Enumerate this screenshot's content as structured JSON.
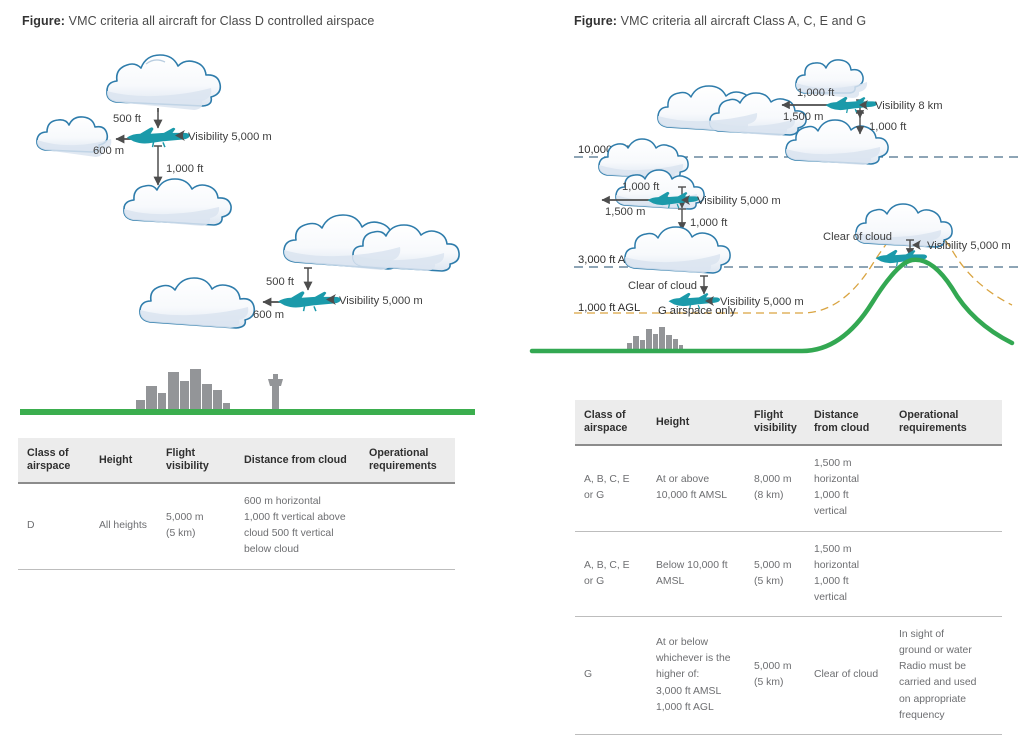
{
  "left_panel": {
    "caption_prefix": "Figure:",
    "caption_text": " VMC criteria all aircraft for Class D controlled airspace",
    "diagram": {
      "labels": {
        "top_vertical": "500 ft",
        "horizontal": "600 m",
        "visibility_top": "Visibility 5,000 m",
        "bottom_vertical": "1,000 ft",
        "lower_vertical": "500 ft",
        "lower_horizontal": "600 m",
        "visibility_lower": "Visibility 5,000 m"
      },
      "colors": {
        "aircraft": "#1b9aaa",
        "ground": "#3bae4e",
        "city": "#939598",
        "cloud_outline": "#2e7cab",
        "cloud_fill": "#ffffff",
        "cloud_shade": "#e2e9f2",
        "arrow": "#4d4d4d"
      }
    },
    "table": {
      "headers": [
        "Class of airspace",
        "Height",
        "Flight visibility",
        "Distance from cloud",
        "Operational requirements"
      ],
      "rows": [
        {
          "class": "D",
          "height": "All heights",
          "visibility": [
            "5,000 m",
            "(5 km)"
          ],
          "distance": [
            "600 m horizontal",
            "1,000 ft vertical above",
            "cloud 500 ft vertical",
            "below cloud"
          ],
          "operational": ""
        }
      ]
    }
  },
  "right_panel": {
    "caption_prefix": "Figure:",
    "caption_text": " VMC criteria all aircraft Class A, C, E and G",
    "diagram": {
      "labels": {
        "a1_vert_top": "1,000 ft",
        "a1_horiz": "1,500 m",
        "a1_vis": "Visibility 8 km",
        "a1_vert_bottom": "1,000 ft",
        "level_10000": "10,000 ft AMSL",
        "a2_vert_top": "1,000 ft",
        "a2_horiz": "1,500 m",
        "a2_vis": "Visibility 5,000 m",
        "a2_vert_bottom": "1,000 ft",
        "level_3000": "3,000 ft AMSL",
        "a3_clear": "Clear of cloud",
        "a3_vis": "Visibility 5,000 m",
        "a3_note": "G airspace only",
        "level_1000": "1,000 ft AGL",
        "a4_clear": "Clear of cloud",
        "a4_vis": "Visibility 5,000 m"
      },
      "colors": {
        "aircraft": "#1b9aaa",
        "terrain": "#33a852",
        "city": "#939598",
        "amsl_line": "#4a6f8a",
        "agl_line": "#d9a441",
        "cloud_outline": "#2e7cab"
      }
    },
    "table": {
      "headers": [
        "Class of airspace",
        "Height",
        "Flight visibility",
        "Distance from cloud",
        "Operational requirements"
      ],
      "rows": [
        {
          "class": [
            "A, B, C, E",
            "or G"
          ],
          "height": [
            "At or above",
            "10,000 ft AMSL"
          ],
          "visibility": [
            "8,000 m",
            "(8 km)"
          ],
          "distance": [
            "1,500 m",
            "horizontal",
            "1,000 ft vertical"
          ],
          "operational": ""
        },
        {
          "class": [
            "A, B, C, E",
            "or G"
          ],
          "height": [
            "Below 10,000 ft",
            "AMSL"
          ],
          "visibility": [
            "5,000 m",
            "(5 km)"
          ],
          "distance": [
            "1,500 m",
            "horizontal",
            "1,000 ft vertical"
          ],
          "operational": ""
        },
        {
          "class": [
            "G"
          ],
          "height": [
            "At or below",
            "whichever is the",
            "higher of:",
            "3,000 ft AMSL",
            "1,000 ft AGL"
          ],
          "visibility": [
            "5,000 m",
            "(5 km)"
          ],
          "distance": [
            "Clear of cloud"
          ],
          "operational": [
            "In sight of",
            "ground or water",
            "Radio must be",
            "carried and used",
            "on appropriate",
            "frequency"
          ]
        }
      ]
    }
  }
}
